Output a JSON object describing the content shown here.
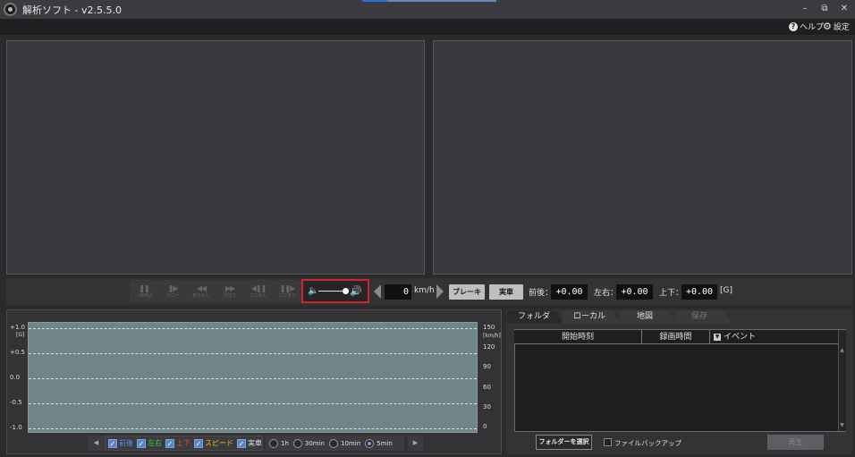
{
  "window": {
    "title": "解析ソフト - v2.5.5.0",
    "minimize": "–",
    "restore": "⧉",
    "close": "✕"
  },
  "header": {
    "help_label": "ヘルプ",
    "settings_label": "設定"
  },
  "playback": {
    "buttons": [
      {
        "glyph": "❚❚",
        "label": "一時停止"
      },
      {
        "glyph": "❚▶",
        "label": "スロー"
      },
      {
        "glyph": "◀◀",
        "label": "巻き戻し"
      },
      {
        "glyph": "▶▶",
        "label": "早送り"
      },
      {
        "glyph": "◀❚❚",
        "label": "コマ戻し"
      },
      {
        "glyph": "❚❚▶",
        "label": "コマ送り"
      }
    ]
  },
  "volume": {
    "level": 0.85
  },
  "speed": {
    "value": "0",
    "unit": "km/h"
  },
  "buttons": {
    "brake": "ブレーキ",
    "real_vehicle": "実車"
  },
  "gsensor": {
    "front_back_label": "前後：",
    "front_back_value": "+0.00",
    "left_right_label": "左右：",
    "left_right_value": "+0.00",
    "up_down_label": "上下：",
    "up_down_value": "+0.00",
    "unit": "[G]"
  },
  "chart_data": {
    "type": "line",
    "series": [],
    "y_left_ticks": [
      "+1.0",
      "+0.5",
      "0.0",
      "-0.5",
      "-1.0"
    ],
    "y_left_unit": "[G]",
    "y_left_range": [
      -1.0,
      1.0
    ],
    "y_right_ticks": [
      "150",
      "120",
      "90",
      "60",
      "30",
      "0"
    ],
    "y_right_unit": "[km/h]",
    "y_right_range": [
      0,
      150
    ],
    "grid": true
  },
  "legend": {
    "items": [
      {
        "label": "前後",
        "color": "#5b8ff0",
        "checked": true
      },
      {
        "label": "左右",
        "color": "#3fbf3f",
        "checked": true
      },
      {
        "label": "上下",
        "color": "#e8453c",
        "checked": true
      },
      {
        "label": "スピード",
        "color": "#f0c419",
        "checked": true
      },
      {
        "label": "実車",
        "color": "#e0e0e0",
        "checked": true
      }
    ]
  },
  "range": {
    "options": [
      "1h",
      "30min",
      "10min",
      "5min"
    ],
    "selected": "5min"
  },
  "tabs": [
    {
      "label": "フォルダ",
      "active": true
    },
    {
      "label": "ローカル",
      "active": false
    },
    {
      "label": "地図",
      "active": false
    },
    {
      "label": "保存",
      "active": false,
      "disabled": true
    }
  ],
  "file_list": {
    "columns": [
      "開始時刻",
      "録画時間",
      "イベント"
    ]
  },
  "folder_button": "フォルダーを選択",
  "backup_label": "ファイルバックアップ",
  "play_button": "再生"
}
